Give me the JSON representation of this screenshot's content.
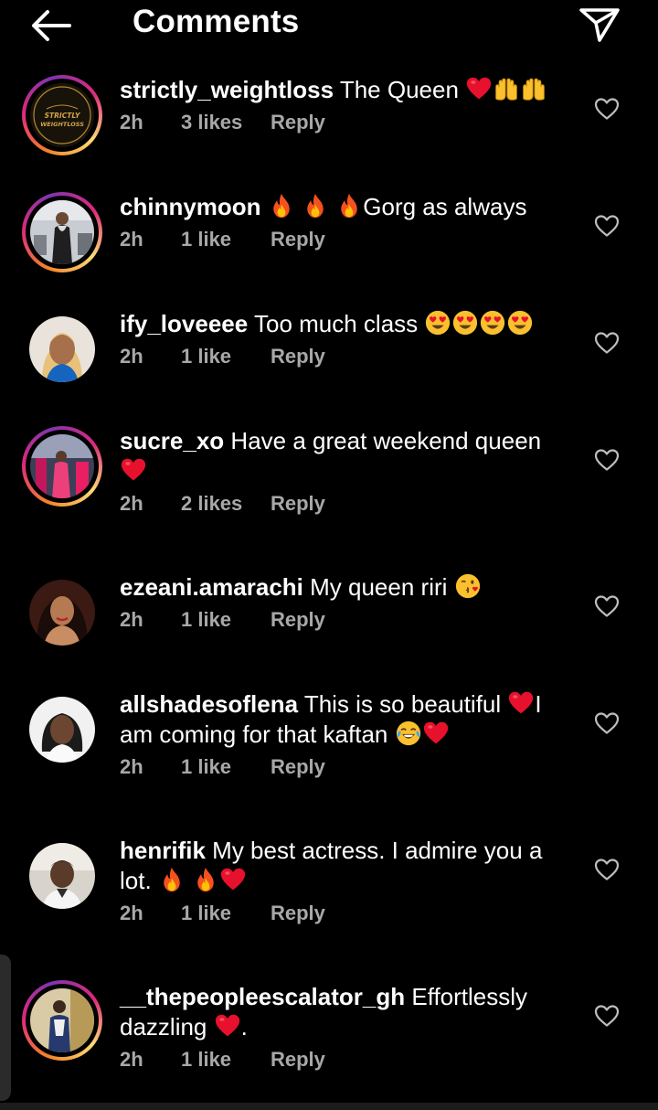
{
  "header": {
    "title": "Comments",
    "back_icon": "arrow-left-icon",
    "share_icon": "paper-plane-icon"
  },
  "colors": {
    "background": "#000000",
    "text": "#ffffff",
    "meta": "#a8a8a8",
    "story_ring": [
      "#f58529",
      "#dd2a7b",
      "#8134af"
    ]
  },
  "comments": [
    {
      "username": "strictly_weightloss",
      "text_parts": [
        "The Queen"
      ],
      "time": "2h",
      "likes": "3 likes",
      "reply": "Reply",
      "logo_text": [
        "STRICTLY",
        "WEIGHTLOSS"
      ]
    },
    {
      "username": "chinnymoon",
      "text_parts": [
        "Gorg as always"
      ],
      "time": "2h",
      "likes": "1 like",
      "reply": "Reply"
    },
    {
      "username": "ify_loveeee",
      "text_parts": [
        "Too much class"
      ],
      "time": "2h",
      "likes": "1 like",
      "reply": "Reply"
    },
    {
      "username": "sucre_xo",
      "text_parts": [
        "Have a great weekend queen"
      ],
      "time": "2h",
      "likes": "2 likes",
      "reply": "Reply"
    },
    {
      "username": "ezeani.amarachi",
      "text_parts": [
        "My queen riri"
      ],
      "time": "2h",
      "likes": "1 like",
      "reply": "Reply"
    },
    {
      "username": "allshadesoflena",
      "text_parts": [
        "This is so beautiful",
        "I am coming for that kaftan"
      ],
      "time": "2h",
      "likes": "1 like",
      "reply": "Reply"
    },
    {
      "username": "henrifik",
      "text_parts": [
        "My best actress. I admire you a lot."
      ],
      "time": "2h",
      "likes": "1 like",
      "reply": "Reply"
    },
    {
      "username": "__thepeopleescalator_gh",
      "text_parts": [
        "Effortlessly dazzling",
        "."
      ],
      "time": "2h",
      "likes": "1 like",
      "reply": "Reply"
    }
  ]
}
